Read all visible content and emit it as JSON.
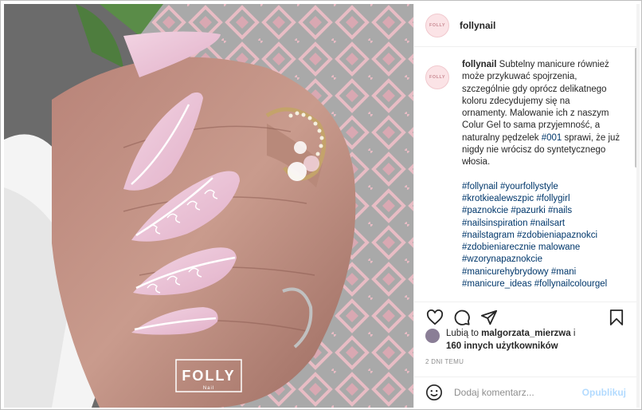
{
  "post": {
    "username": "follynail",
    "avatar_logo_text": "FOLLY",
    "photo_logo": {
      "main": "FOLLY",
      "sub": "Nail"
    },
    "caption": {
      "username": "follynail",
      "lines": [
        "Subtelny manicure również",
        "może przykuwać spojrzenia,",
        "szczególnie gdy oprócz delikatnego",
        "koloru zdecydujemy się na",
        "ornamenty. Malowanie ich z naszym",
        "Colur Gel to sama przyjemność, a",
        "naturalny pędzelek ",
        "#001",
        " sprawi, że już",
        "nigdy nie wrócisz do syntetycznego",
        "włosia."
      ],
      "hashtag_lines": [
        "#follynail #yourfollystyle",
        "#krotkiealewszpic #follygirl",
        "#paznokcie #pazurki #nails",
        "#nailsinspiration #nailsart",
        "#nailstagram #zdobieniapaznokci",
        "#zdobieniarecznie malowane",
        "#wzorynapaznokcie",
        "#manicurehybrydowy #mani",
        "#manicure_ideas #follynailcolourgel"
      ]
    },
    "actions": {
      "like": "heart-icon",
      "comment": "comment-icon",
      "share": "share-icon",
      "save": "bookmark-icon"
    },
    "likes": {
      "prefix": "Lubią to",
      "user": "malgorzata_mierzwa",
      "suffix": "i",
      "others": "160 innych użytkowników"
    },
    "time": "2 DNI TEMU",
    "comment_box": {
      "placeholder": "Dodaj komentarz...",
      "post_label": "Opublikuj"
    },
    "colors": {
      "link": "#00376b",
      "post_disabled": "#b3dbff",
      "nail_pink": "#eabfd4"
    }
  }
}
